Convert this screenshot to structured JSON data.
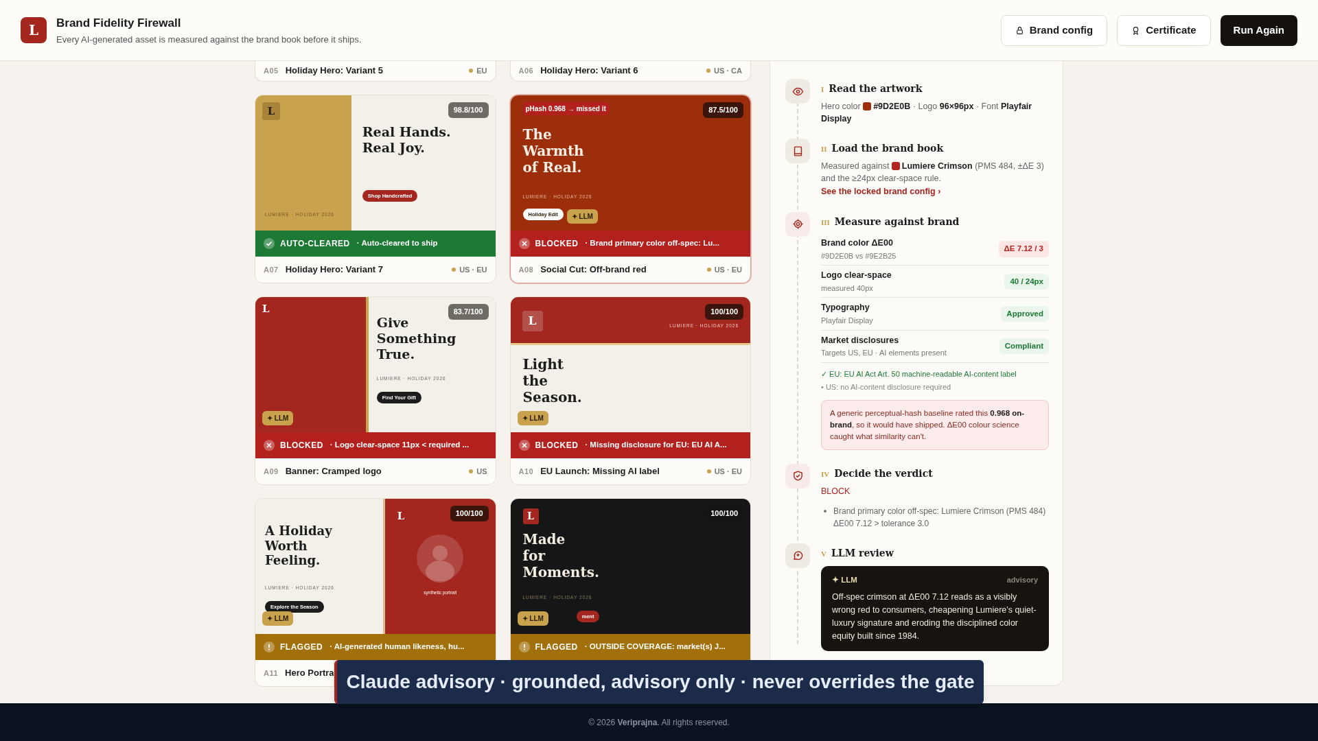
{
  "header": {
    "logo": "L",
    "title": "Brand Fidelity Firewall",
    "subtitle": "Every AI-generated asset is measured against the brand book before it ships.",
    "buttons": [
      {
        "label": "Brand config",
        "kind": "outline"
      },
      {
        "label": "Certificate",
        "kind": "outline"
      },
      {
        "label": "Run Again",
        "kind": "primary"
      }
    ]
  },
  "cards": [
    {
      "id": "A05",
      "title": "Holiday Hero: Variant 5",
      "markets": "EU",
      "selected": false
    },
    {
      "id": "A06",
      "title": "Holiday Hero: Variant 6",
      "markets": "US · CA",
      "selected": false
    },
    {
      "id": "A07",
      "title": "Holiday Hero: Variant 7",
      "markets": "US · EU",
      "selected": false,
      "score": "98.8/100",
      "status": {
        "kind": "cleared",
        "label": "AUTO-CLEARED",
        "reason": "· Auto-cleared to ship"
      },
      "art": {
        "kind": "split",
        "logo": "L",
        "headline": "Real Hands.\nReal Joy.",
        "tagline": "LUMIERE · HOLIDAY 2026",
        "cta": "Shop Handcrafted"
      }
    },
    {
      "id": "A08",
      "title": "Social Cut: Off-brand red",
      "markets": "US · EU",
      "selected": true,
      "score": "87.5/100",
      "status": {
        "kind": "blocked",
        "label": "BLOCKED",
        "reason": "· Brand primary color off-spec: Lu..."
      },
      "art": {
        "kind": "full",
        "tag": "pHash 0.968 → missed it",
        "headline": "The\nWarmth\nof Real.",
        "tagline": "LUMIERE · HOLIDAY 2026",
        "cta": "Holiday Edit",
        "badge": "✦ LLM"
      }
    },
    {
      "id": "A09",
      "title": "Banner: Cramped logo",
      "markets": "US",
      "selected": false,
      "score": "83.7/100",
      "status": {
        "kind": "blocked",
        "label": "BLOCKED",
        "reason": "· Logo clear-space 11px < required ..."
      },
      "art": {
        "kind": "banner",
        "logo": "L",
        "headline": "Give\nSomething\nTrue.",
        "tagline": "LUMIERE · HOLIDAY 2026",
        "cta": "Find Your Gift",
        "badge": "✦ LLM"
      }
    },
    {
      "id": "A10",
      "title": "EU Launch: Missing AI label",
      "markets": "US · EU",
      "selected": false,
      "score": "100/100",
      "status": {
        "kind": "blocked",
        "label": "BLOCKED",
        "reason": "· Missing disclosure for EU: EU AI A..."
      },
      "art": {
        "kind": "band",
        "logo": "L",
        "headline": "Light\nthe\nSeason.",
        "tagline": "LUMIERE · HOLIDAY 2026",
        "badge": "✦ LLM"
      }
    },
    {
      "id": "A11",
      "title": "Hero Portra",
      "selected": false,
      "score": "100/100",
      "status": {
        "kind": "flagged",
        "label": "FLAGGED",
        "reason": "· AI-generated human likeness, hu..."
      },
      "art": {
        "kind": "portrait",
        "logo": "L",
        "headline": "A Holiday\nWorth\nFeeling.",
        "tagline": "LUMIERE · HOLIDAY 2026",
        "cta": "Explore the Season",
        "caption": "synthetic portrait",
        "badge": "✦ LLM"
      }
    },
    {
      "selected": false,
      "score": "100/100",
      "status": {
        "kind": "flagged",
        "label": "FLAGGED",
        "reason": "· OUTSIDE COVERAGE: market(s) J..."
      },
      "art": {
        "kind": "dark",
        "logo": "L",
        "headline": "Made\nfor\nMoments.",
        "tagline": "LUMIERE · HOLIDAY 2026",
        "cta": "ment",
        "badge": "✦ LLM"
      }
    }
  ],
  "steps": [
    {
      "numeral": "I",
      "title": "Read the artwork",
      "kind": "text",
      "before": "Hero color",
      "color": "#9d2e0b",
      "after": "**#9D2E0B** · Logo **96×96px** · Font **Playfair Display**"
    },
    {
      "numeral": "II",
      "title": "Load the brand book",
      "kind": "text",
      "before": "Measured against",
      "color": "#b3261e",
      "after": "**Lumiere Crimson** (PMS 484, ±ΔE 3) and the ≥24px clear-space rule.",
      "link": "See the locked brand config ›"
    },
    {
      "numeral": "III",
      "title": "Measure against brand",
      "kind": "checks",
      "checks": [
        {
          "label": "Brand color ΔE00",
          "detail": "#9D2E0B vs #9E2B25",
          "result": "ΔE 7.12 / 3",
          "passed": false
        },
        {
          "label": "Logo clear-space",
          "detail": "measured 40px",
          "result": "40 / 24px",
          "passed": true
        },
        {
          "label": "Typography",
          "detail": "Playfair Display",
          "result": "Approved",
          "passed": true
        },
        {
          "label": "Market disclosures",
          "detail": "Targets US, EU · AI elements present",
          "result": "Compliant",
          "passed": true
        }
      ],
      "notes": [
        {
          "text": "✓ EU: EU AI Act Art. 50 machine-readable AI-content label",
          "kind": "ok"
        },
        {
          "text": "• US: no AI-content disclosure required",
          "kind": "info"
        }
      ],
      "callout": "A generic perceptual-hash baseline rated this **0.968 on-brand**, so it would have shipped. ΔE00 colour science caught what similarity can't."
    },
    {
      "numeral": "IV",
      "title": "Decide the verdict",
      "kind": "verdict",
      "verdict": "BLOCK",
      "reasons": [
        "Brand primary color off-spec: Lumiere Crimson (PMS 484) ΔE00 7.12 > tolerance 3.0"
      ]
    },
    {
      "numeral": "V",
      "title": "LLM review",
      "kind": "llm",
      "label": "✦ LLM",
      "tag": "advisory",
      "text": "Off-spec crimson at ΔE00 7.12 reads as a visibly wrong red to consumers, cheapening Lumiere's quiet-luxury signature and eroding the disciplined color equity built since 1984."
    }
  ],
  "caption": "Claude advisory · grounded, advisory only · never overrides the gate",
  "footer": "© 2026 **Veriprajna**. All rights reserved."
}
